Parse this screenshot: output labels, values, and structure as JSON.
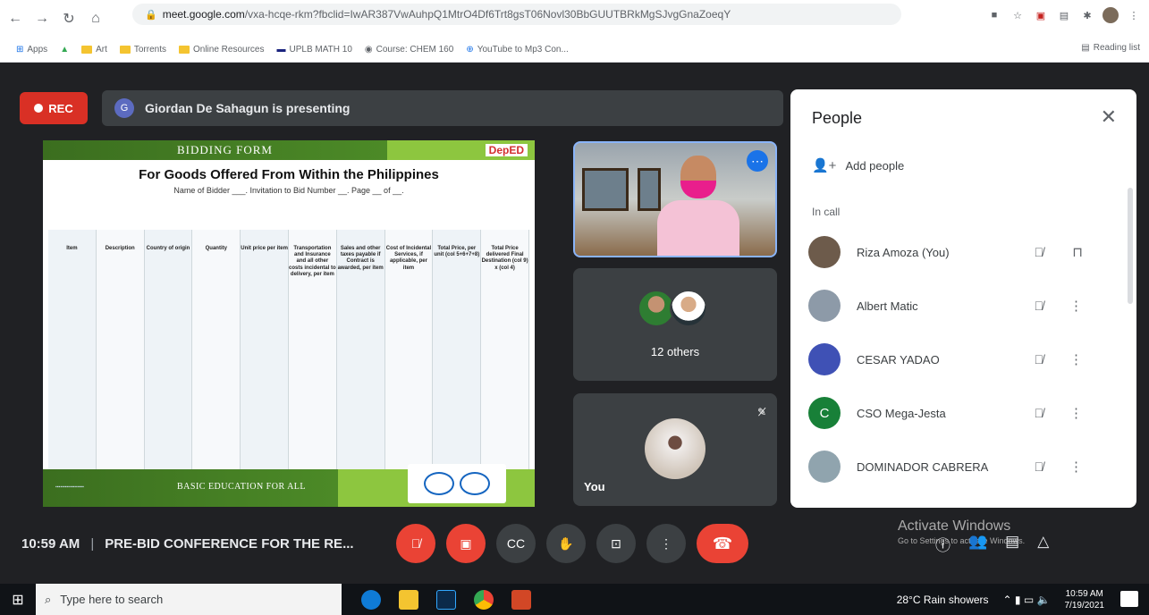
{
  "browser": {
    "url_host": "meet.google.com",
    "url_path": "/vxa-hcqe-rkm?fbclid=IwAR387VwAuhpQ1MtrO4Df6Trt8gsT06Novl30BbGUUTBRkMgSJvgGnaZoeqY",
    "bookmarks": [
      "Apps",
      "Art",
      "Torrents",
      "Online Resources",
      "UPLB MATH 10",
      "Course: CHEM 160",
      "YouTube to Mp3 Con..."
    ],
    "reading_list": "Reading list"
  },
  "meet": {
    "rec_label": "REC",
    "presenter_initial": "G",
    "presenting_text": "Giordan De Sahagun is presenting",
    "tile_other_count": "12 others",
    "you_label": "You",
    "time": "10:59 AM",
    "separator": "|",
    "meeting_title": "PRE-BID CONFERENCE FOR THE RE..."
  },
  "slide": {
    "header": "BIDDING FORM",
    "logo": "DepED",
    "title": "For Goods Offered From Within the Philippines",
    "subtitle": "Name of Bidder ___. Invitation to Bid Number __. Page __ of __.",
    "columns": [
      "Item",
      "Description",
      "Country of origin",
      "Quantity",
      "Unit price per item",
      "Transportation and Insurance and all other costs incidental to delivery, per item",
      "Sales and other taxes payable if Contract is awarded, per item",
      "Cost of Incidental Services, if applicable, per item",
      "Total Price, per unit (col 5+6+7+8)",
      "Total Price delivered Final Destination (col 9) x (col 4)"
    ],
    "motto": "BASIC EDUCATION FOR ALL"
  },
  "people_panel": {
    "title": "People",
    "add_people": "Add people",
    "in_call": "In call",
    "participants": [
      {
        "name": "Riza Amoza (You)",
        "color": "#6d5b4b"
      },
      {
        "name": "Albert Matic",
        "color": "#8d9aa8"
      },
      {
        "name": "CESAR YADAO",
        "color": "#3f51b5"
      },
      {
        "name": "CSO Mega-Jesta",
        "color": "#188038",
        "initial": "C"
      },
      {
        "name": "DOMINADOR CABRERA",
        "color": "#90a4ae"
      }
    ]
  },
  "watermark": {
    "line1": "Activate Windows",
    "line2": "Go to Settings to activate Windows."
  },
  "taskbar": {
    "search_placeholder": "Type here to search",
    "weather": "28°C  Rain showers",
    "time": "10:59 AM",
    "date": "7/19/2021"
  }
}
